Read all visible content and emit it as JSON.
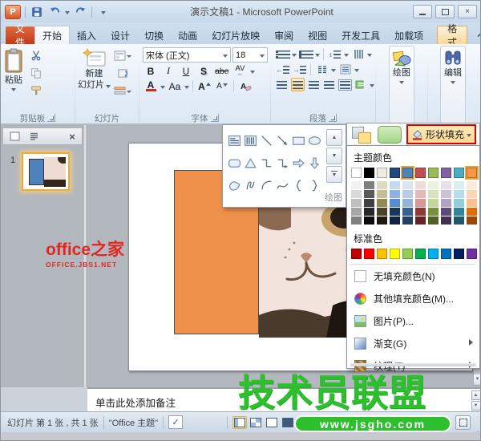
{
  "window": {
    "title": "演示文稿1 - Microsoft PowerPoint"
  },
  "tabs": {
    "file": "文件",
    "items": [
      {
        "key": "home",
        "label": "开始",
        "active": true
      },
      {
        "key": "insert",
        "label": "插入"
      },
      {
        "key": "design",
        "label": "设计"
      },
      {
        "key": "transitions",
        "label": "切换"
      },
      {
        "key": "animations",
        "label": "动画"
      },
      {
        "key": "slideshow",
        "label": "幻灯片放映"
      },
      {
        "key": "review",
        "label": "审阅"
      },
      {
        "key": "view",
        "label": "视图"
      },
      {
        "key": "developer",
        "label": "开发工具"
      },
      {
        "key": "addins",
        "label": "加载项"
      }
    ],
    "contextual": "格式",
    "help": "?"
  },
  "ribbon": {
    "clipboard": {
      "paste": "粘贴",
      "label": "剪贴板"
    },
    "slides": {
      "new_slide_line1": "新建",
      "new_slide_line2": "幻灯片",
      "label": "幻灯片"
    },
    "font": {
      "family": "宋体 (正文)",
      "size": "18",
      "bold": "B",
      "italic": "I",
      "underline": "U",
      "shadow": "S",
      "strike": "abe",
      "spacing": "AV",
      "font_color": "A",
      "change_case": "Aa",
      "grow": "A",
      "shrink": "A",
      "label": "字体"
    },
    "paragraph": {
      "label": "段落"
    },
    "drawing": {
      "label": "绘图"
    },
    "editing": {
      "label": "编辑"
    }
  },
  "drawing_panel": {
    "shapes": [
      "textbox-horizontal",
      "textbox-vertical",
      "line",
      "arrow",
      "rectangle",
      "oval",
      "rounded-rectangle",
      "triangle",
      "elbow-connector",
      "elbow-arrow-connector",
      "block-arrow-right",
      "block-arrow-down",
      "freeform",
      "scribble",
      "arc",
      "curve",
      "left-brace",
      "right-brace"
    ],
    "footer": "绘图",
    "shape_fill_label": "形状填充"
  },
  "fill_menu": {
    "theme_label": "主题颜色",
    "standard_label": "标准色",
    "theme_colors": [
      "#FFFFFF",
      "#000000",
      "#EEECE1",
      "#1F497D",
      "#4F81BD",
      "#C0504D",
      "#9BBB59",
      "#8064A2",
      "#4BACC6",
      "#F79646"
    ],
    "selected_indices": [
      4,
      9
    ],
    "theme_variants": [
      [
        "#F2F2F2",
        "#D9D9D9",
        "#BFBFBF",
        "#A6A6A6",
        "#808080"
      ],
      [
        "#7F7F7F",
        "#595959",
        "#404040",
        "#262626",
        "#0D0D0D"
      ],
      [
        "#DDD9C3",
        "#C4BD97",
        "#938953",
        "#494429",
        "#1D1B10"
      ],
      [
        "#C6D9F0",
        "#8DB3E2",
        "#548DD4",
        "#17365D",
        "#0F243E"
      ],
      [
        "#DBE5F1",
        "#B8CCE4",
        "#95B3D7",
        "#366092",
        "#244061"
      ],
      [
        "#F2DCDB",
        "#E5B9B7",
        "#D99694",
        "#953734",
        "#632423"
      ],
      [
        "#EBF1DD",
        "#D7E3BC",
        "#C3D69B",
        "#76923C",
        "#4F6128"
      ],
      [
        "#E5E0EC",
        "#CCC1D9",
        "#B2A2C7",
        "#5F497A",
        "#3F3151"
      ],
      [
        "#DBEEF3",
        "#B7DDE8",
        "#92CDDC",
        "#31859B",
        "#205867"
      ],
      [
        "#FDEADA",
        "#FBD5B5",
        "#FAC08F",
        "#E36C09",
        "#974806"
      ]
    ],
    "standard_colors": [
      "#C00000",
      "#FF0000",
      "#FFC000",
      "#FFFF00",
      "#92D050",
      "#00B050",
      "#00B0F0",
      "#0070C0",
      "#002060",
      "#7030A0"
    ],
    "items": [
      {
        "key": "no-fill",
        "label": "无填充颜色(N)",
        "icon": "no-fill-icon",
        "submenu": false
      },
      {
        "key": "more-fill-colors",
        "label": "其他填充颜色(M)...",
        "icon": "more-fill-colors-icon",
        "submenu": false
      },
      {
        "key": "picture",
        "label": "图片(P)...",
        "icon": "picture-icon",
        "submenu": false
      },
      {
        "key": "gradient",
        "label": "渐变(G)",
        "icon": "gradient-icon",
        "submenu": true
      },
      {
        "key": "texture",
        "label": "纹理(T)",
        "icon": "texture-icon",
        "submenu": true
      }
    ]
  },
  "slides_pane": {
    "slide_number": "1"
  },
  "canvas": {
    "rect_fill": "#EF914B",
    "thumb_rect_fill": "#4F81BD"
  },
  "notes": {
    "placeholder": "单击此处添加备注"
  },
  "statusbar": {
    "slide_info": "幻灯片 第 1 张 , 共 1 张",
    "theme": "\"Office 主题\""
  },
  "watermarks": {
    "red_title": "office之家",
    "red_sub": "OFFICE.JBS1.NET",
    "green_title": "技术员联盟",
    "green_url": "www.jsgho.com"
  }
}
